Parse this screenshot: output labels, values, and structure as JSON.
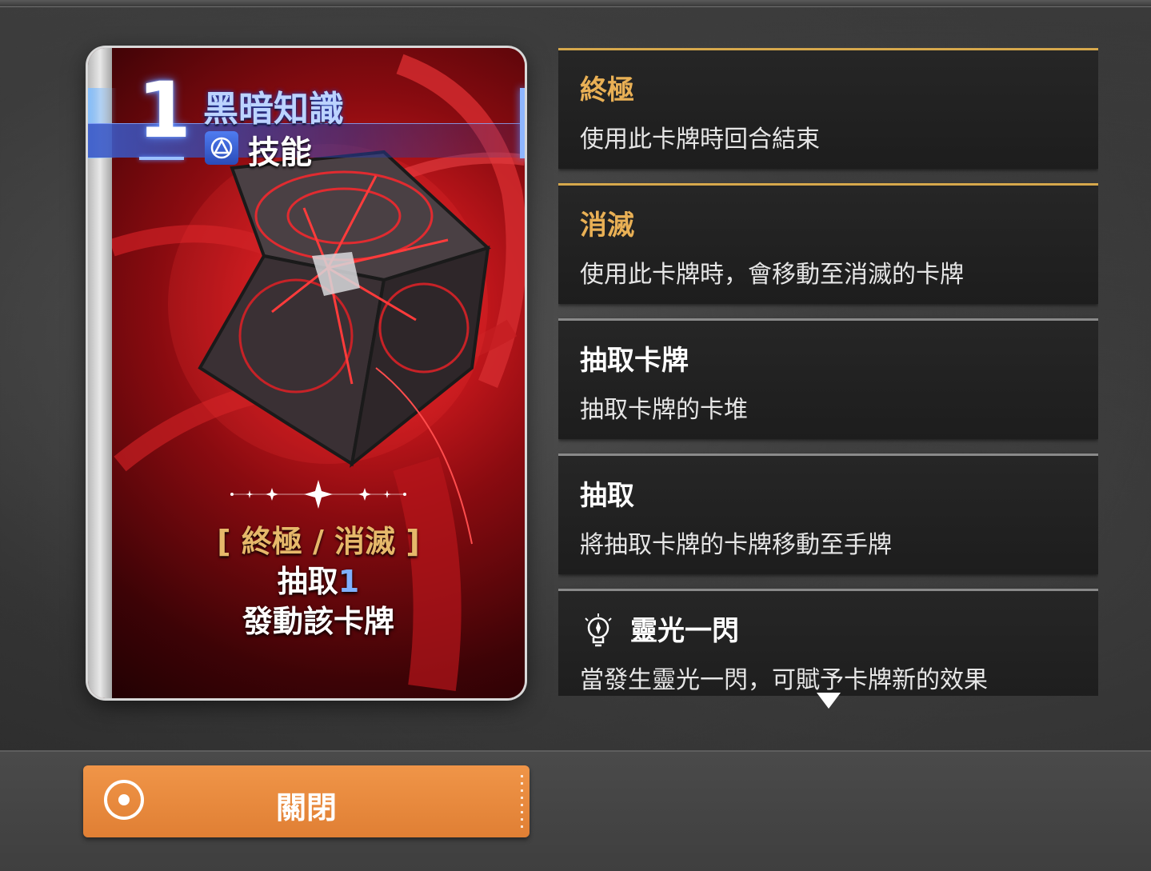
{
  "card": {
    "cost": "1",
    "name": "黑暗知識",
    "type": "技能",
    "type_icon": "skill-triangle-icon",
    "tags": "[ 終極 / 消滅 ]",
    "effect_prefix": "抽取",
    "effect_value": "1",
    "effect_line2": "發動該卡牌"
  },
  "keywords": [
    {
      "title": "終極",
      "desc": "使用此卡牌時回合結束",
      "accent": "gold"
    },
    {
      "title": "消滅",
      "desc": "使用此卡牌時，會移動至消滅的卡牌",
      "accent": "gold"
    },
    {
      "title": "抽取卡牌",
      "desc": "抽取卡牌的卡堆",
      "accent": "gray"
    },
    {
      "title": "抽取",
      "desc": "將抽取卡牌的卡牌移動至手牌",
      "accent": "gray"
    },
    {
      "title": "靈光一閃",
      "desc": "當發生靈光一閃，可賦予卡牌新的效果",
      "accent": "gray",
      "icon": "lightbulb-icon"
    }
  ],
  "footer": {
    "close_label": "關閉"
  },
  "colors": {
    "gold_accent": "#e9b055",
    "button_orange": "#e8883a",
    "cost_blue": "#7fb0ff"
  }
}
